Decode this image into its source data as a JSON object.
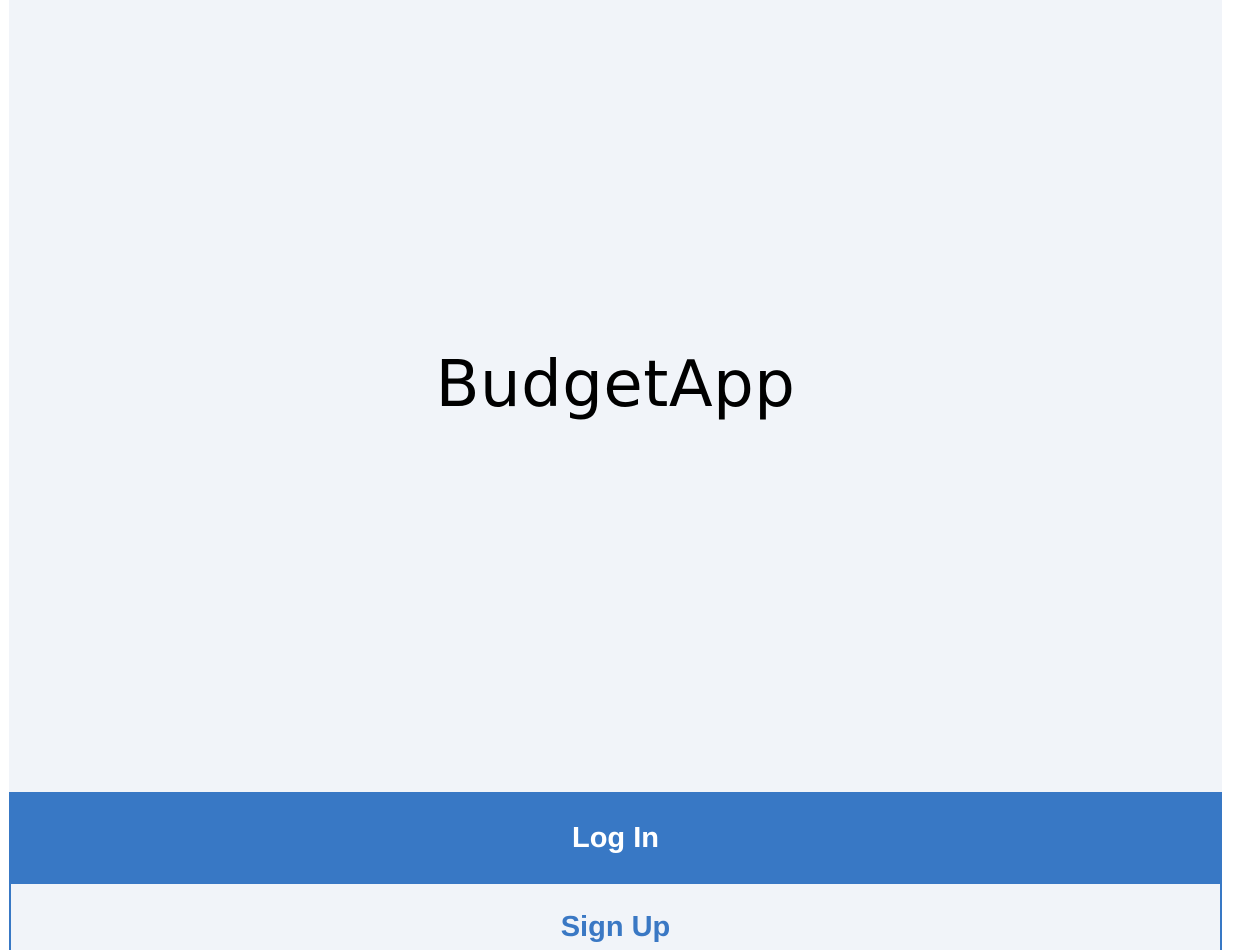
{
  "app": {
    "title": "BudgetApp"
  },
  "actions": {
    "login_label": "Log In",
    "signup_label": "Sign Up"
  },
  "colors": {
    "background": "#f1f4f9",
    "primary": "#3878c5",
    "primary_text": "#ffffff",
    "title_text": "#000000"
  }
}
